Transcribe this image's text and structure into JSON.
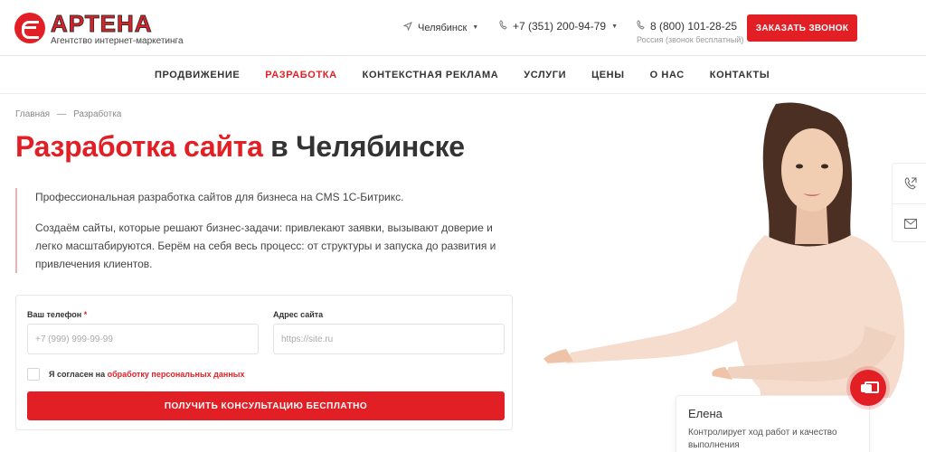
{
  "header": {
    "logo_text": "АРТЕНА",
    "logo_tagline": "Агентство интернет-маркетинга",
    "city": "Челябинск",
    "phone_main": "+7 (351) 200-94-79",
    "phone_free": "8 (800) 101-28-25",
    "phone_free_note": "Россия (звонок бесплатный)",
    "callback_button": "ЗАКАЗАТЬ ЗВОНОК"
  },
  "nav": {
    "items": [
      {
        "label": "ПРОДВИЖЕНИЕ"
      },
      {
        "label": "РАЗРАБОТКА"
      },
      {
        "label": "КОНТЕКСТНАЯ РЕКЛАМА"
      },
      {
        "label": "УСЛУГИ"
      },
      {
        "label": "ЦЕНЫ"
      },
      {
        "label": "О НАС"
      },
      {
        "label": "КОНТАКТЫ"
      }
    ],
    "active": "РАЗРАБОТКА"
  },
  "breadcrumb": {
    "home": "Главная",
    "separator": "—",
    "current": "Разработка"
  },
  "hero": {
    "title_accent": "Разработка сайта",
    "title_rest": " в Челябинске",
    "paragraph1": "Профессиональная разработка сайтов для бизнеса на CMS 1С-Битрикс.",
    "paragraph2": "Создаём сайты, которые решают бизнес-задачи: привлекают заявки, вызывают доверие и легко масштабируются. Берём на себя весь процесс: от структуры и запуска до развития и привлечения клиентов."
  },
  "form": {
    "phone_label": "Ваш телефон",
    "required_mark": "*",
    "phone_placeholder": "+7 (999) 999-99-99",
    "site_label": "Адрес сайта",
    "site_placeholder": "https://site.ru",
    "consent_prefix": "Я согласен на ",
    "consent_link": "обработку персональных данных",
    "submit": "ПОЛУЧИТЬ КОНСУЛЬТАЦИЮ БЕСПЛАТНО"
  },
  "manager": {
    "name": "Елена",
    "role": "Контролирует ход работ и качество выполнения"
  },
  "colors": {
    "accent": "#e31f26",
    "text": "#333333",
    "border": "#e7e7e7"
  },
  "icons": [
    "location-arrow-icon",
    "phone-icon",
    "callback-icon",
    "mail-icon",
    "chat-icon"
  ]
}
